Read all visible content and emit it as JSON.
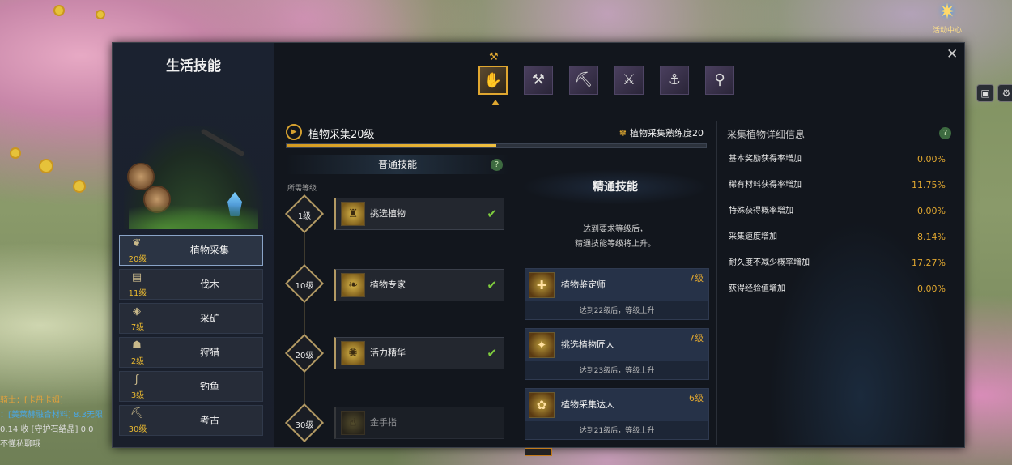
{
  "hud": {
    "event_center": {
      "label": "活动中心",
      "icon": "event-star-icon"
    },
    "chat": [
      {
        "text": "骑士：[卡丹卡姆]",
        "color": "#e6a23a"
      },
      {
        "text": "：[美莱赫融合材料] 8.3无限",
        "color": "#4aa8e6"
      },
      {
        "text": "0.14 收 [守护石结晶] 0.0",
        "color": "#dddddd"
      },
      {
        "text": "不懂私聊哦",
        "color": "#dddddd"
      }
    ]
  },
  "window": {
    "title": "生活技能",
    "close_icon": "close-icon"
  },
  "categories": [
    {
      "name": "植物采集",
      "level": "20级",
      "icon": "sprout-icon",
      "glyph": "❦",
      "active": true
    },
    {
      "name": "伐木",
      "level": "11级",
      "icon": "log-icon",
      "glyph": "▤",
      "active": false
    },
    {
      "name": "采矿",
      "level": "7级",
      "icon": "ore-icon",
      "glyph": "◈",
      "active": false
    },
    {
      "name": "狩猎",
      "level": "2级",
      "icon": "hunting-icon",
      "glyph": "☗",
      "active": false
    },
    {
      "name": "钓鱼",
      "level": "3级",
      "icon": "fishhook-icon",
      "glyph": "ʃ",
      "active": false
    },
    {
      "name": "考古",
      "level": "30级",
      "icon": "shovel-icon",
      "glyph": "⛏",
      "active": false
    }
  ],
  "tool_tabs": [
    {
      "icon": "gathering-glove-icon",
      "glyph": "✋",
      "active": true
    },
    {
      "icon": "axe-icon",
      "glyph": "⚒",
      "active": false
    },
    {
      "icon": "pickaxe-icon",
      "glyph": "⛏",
      "active": false
    },
    {
      "icon": "hunting-knife-icon",
      "glyph": "⚔",
      "active": false
    },
    {
      "icon": "fishing-rod-icon",
      "glyph": "⚓",
      "active": false
    },
    {
      "icon": "shovel-icon",
      "glyph": "⚲",
      "active": false
    }
  ],
  "skill": {
    "title": "植物采集20级",
    "proficiency_label": "植物采集熟练度20",
    "progress": 0.5
  },
  "normal_skills": {
    "header": "普通技能",
    "required_level_label": "所需等级",
    "help": "?",
    "items": [
      {
        "level": "1级",
        "name": "挑选植物",
        "icon": "helmet-icon",
        "glyph": "♜",
        "unlocked": true
      },
      {
        "level": "10级",
        "name": "植物专家",
        "icon": "leaves-icon",
        "glyph": "❧",
        "unlocked": true
      },
      {
        "level": "20级",
        "name": "活力精华",
        "icon": "essence-icon",
        "glyph": "✺",
        "unlocked": true
      },
      {
        "level": "30级",
        "name": "金手指",
        "icon": "golden-finger-icon",
        "glyph": "☝",
        "unlocked": false
      }
    ]
  },
  "mastery": {
    "title": "精通技能",
    "desc_line1": "达到要求等级后，",
    "desc_line2": "精通技能等级将上升。",
    "items": [
      {
        "name": "植物鉴定师",
        "level": "7级",
        "condition": "达到22级后，等级上升",
        "icon": "appraiser-icon",
        "glyph": "✚"
      },
      {
        "name": "挑选植物匠人",
        "level": "7级",
        "condition": "达到23级后，等级上升",
        "icon": "artisan-icon",
        "glyph": "✦"
      },
      {
        "name": "植物采集达人",
        "level": "6级",
        "condition": "达到21级后，等级上升",
        "icon": "expert-icon",
        "glyph": "✿"
      }
    ]
  },
  "details": {
    "title": "采集植物详细信息",
    "help": "?",
    "rows": [
      {
        "label": "基本奖励获得率增加",
        "value": "0.00%"
      },
      {
        "label": "稀有材料获得率增加",
        "value": "11.75%"
      },
      {
        "label": "特殊获得概率增加",
        "value": "0.00%"
      },
      {
        "label": "采集速度增加",
        "value": "8.14%"
      },
      {
        "label": "耐久度不减少概率增加",
        "value": "17.27%"
      },
      {
        "label": "获得经验值增加",
        "value": "0.00%"
      }
    ]
  }
}
